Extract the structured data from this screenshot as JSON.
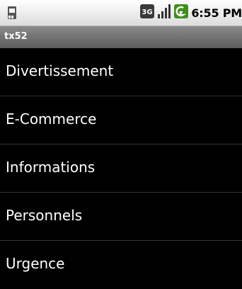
{
  "status_bar": {
    "time": "6:55 PM",
    "icons": [
      "sd-card-icon",
      "3g-icon",
      "signal-icon",
      "battery-icon"
    ]
  },
  "title_bar": {
    "title": "tx52"
  },
  "list": {
    "items": [
      {
        "label": "Divertissement"
      },
      {
        "label": "E-Commerce"
      },
      {
        "label": "Informations"
      },
      {
        "label": "Personnels"
      },
      {
        "label": "Urgence"
      }
    ]
  }
}
